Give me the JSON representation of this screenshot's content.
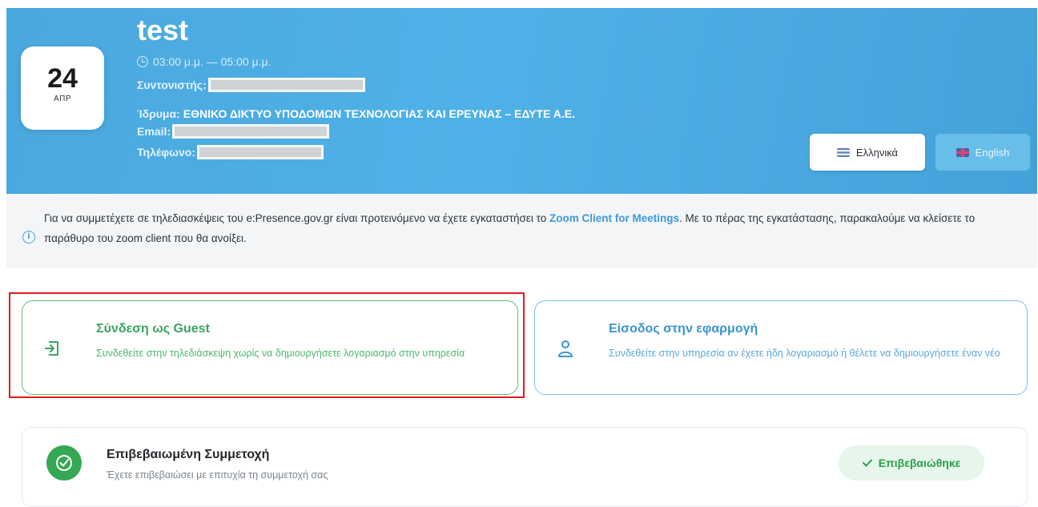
{
  "event": {
    "day": "24",
    "month": "ΑΠΡ",
    "title": "test",
    "time": "03:00 μ.μ. — 05:00 μ.μ.",
    "coordinator_label": "Συντονιστής:",
    "institution_label": "Ίδρυμα:",
    "institution_value": "ΕΘΝΙΚΟ ΔΙΚΤΥΟ ΥΠΟΔΟΜΩΝ ΤΕΧΝΟΛΟΓΙΑΣ ΚΑΙ ΕΡΕΥΝΑΣ – ΕΔΥΤΕ Α.Ε.",
    "email_label": "Email:",
    "phone_label": "Τηλέφωνο:"
  },
  "languages": {
    "greek": "Ελληνικά",
    "english": "English"
  },
  "info": {
    "text_before": "Για να συμμετέχετε σε τηλεδιασκέψεις του e:Presence.gov.gr είναι προτεινόμενο να έχετε εγκαταστήσει το ",
    "link": "Zoom Client for Meetings",
    "text_after": ". Με το πέρας της εγκατάστασης, παρακαλούμε να κλείσετε το παράθυρο του zoom client που θα ανοίξει."
  },
  "guest_card": {
    "title": "Σύνδεση ως Guest",
    "description": "Συνδεθείτε στην τηλεδιάσκεψη χωρίς να δημιουργήσετε λογαριασμό στην υπηρεσία"
  },
  "login_card": {
    "title": "Είσοδος στην εφαρμογή",
    "description": "Συνδεθείτε στην υπηρεσία αν έχετε ήδη λογαριασμό ή θέλετε να δημιουργήσετε έναν νέο"
  },
  "confirmation": {
    "title": "Επιβεβαιωμένη Συμμετοχή",
    "subtitle": "Έχετε επιβεβαιώσει με επιτυχία τη συμμετοχή σας",
    "badge": "Επιβεβαιώθηκε"
  },
  "colors": {
    "header_blue": "#4fb1e7",
    "guest_green": "#3aa55d",
    "login_blue": "#3b93d0",
    "highlight_red": "#e11b1b"
  }
}
